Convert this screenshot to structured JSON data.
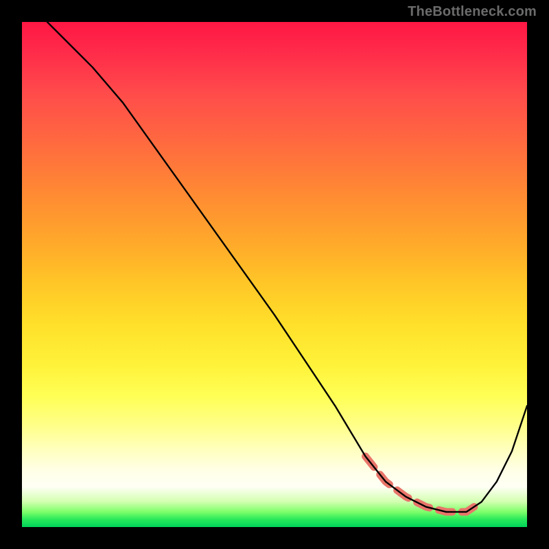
{
  "watermark": "TheBottleneck.com",
  "chart_data": {
    "type": "line",
    "title": "",
    "xlabel": "",
    "ylabel": "",
    "xlim": [
      0,
      100
    ],
    "ylim": [
      0,
      100
    ],
    "grid": false,
    "legend": false,
    "series": [
      {
        "name": "bottleneck-curve",
        "x": [
          5,
          9,
          14,
          20,
          30,
          40,
          50,
          58,
          62,
          65,
          68,
          72,
          76,
          80,
          84,
          88,
          91,
          94,
          97,
          100
        ],
        "y": [
          100,
          96,
          91,
          84,
          70,
          56,
          42,
          30,
          24,
          19,
          14,
          9,
          6,
          4,
          3,
          3,
          5,
          9,
          15,
          24
        ]
      }
    ],
    "optimal_band": {
      "name": "optimal-range",
      "x": [
        68,
        72,
        76,
        80,
        84,
        88,
        91
      ],
      "y": [
        14,
        9,
        6,
        4,
        3,
        3,
        5
      ]
    },
    "colors": {
      "gradient_top": "#ff1744",
      "gradient_mid": "#ffe02a",
      "gradient_bottom": "#00d45a",
      "curve": "#000000",
      "band": "#e8756a"
    }
  }
}
